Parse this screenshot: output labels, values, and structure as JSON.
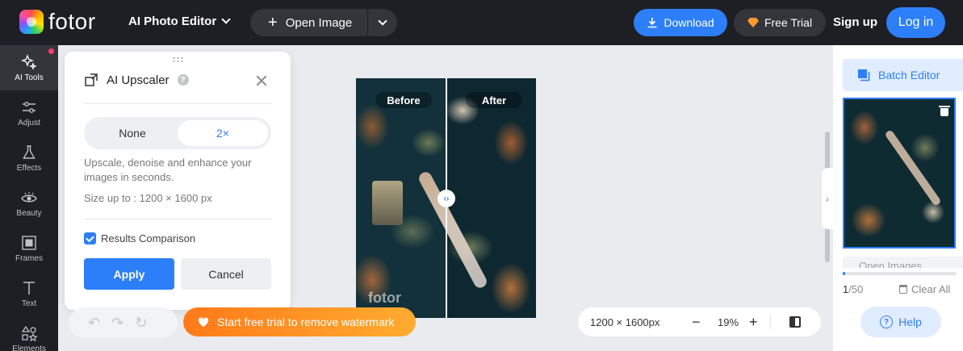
{
  "app": {
    "brand": "fotor"
  },
  "header": {
    "editor_menu": "AI Photo Editor",
    "open_image": "Open Image",
    "download": "Download",
    "free_trial": "Free Trial",
    "sign_up": "Sign up",
    "log_in": "Log in"
  },
  "sidebar": {
    "items": [
      {
        "label": "AI Tools",
        "icon": "sparkle-icon"
      },
      {
        "label": "Adjust",
        "icon": "sliders-icon"
      },
      {
        "label": "Effects",
        "icon": "flask-icon"
      },
      {
        "label": "Beauty",
        "icon": "eye-icon"
      },
      {
        "label": "Frames",
        "icon": "frame-icon"
      },
      {
        "label": "Text",
        "icon": "text-icon"
      },
      {
        "label": "Elements",
        "icon": "shapes-icon"
      }
    ]
  },
  "panel": {
    "title": "AI Upscaler",
    "options": [
      "None",
      "2×"
    ],
    "selected_option": "2×",
    "description": "Upscale, denoise and enhance your images in seconds.",
    "size_note": "Size up to : 1200 × 1600 px",
    "results_comparison": "Results Comparison",
    "results_comparison_checked": true,
    "apply": "Apply",
    "cancel": "Cancel"
  },
  "canvas": {
    "before_label": "Before",
    "after_label": "After",
    "watermark": "fotor",
    "trial_banner": "Start free trial to remove watermark",
    "dimensions": "1200 × 1600px",
    "zoom": "19%"
  },
  "right_panel": {
    "batch_editor": "Batch Editor",
    "open_images": "Open Images",
    "count_current": "1",
    "count_total": "/50",
    "progress_fraction": 0.02,
    "clear_all": "Clear All",
    "help": "Help"
  },
  "colors": {
    "accent": "#2d7ff9",
    "dark_bg": "#1e1f24",
    "trial_orange": "#ff8a1f"
  }
}
